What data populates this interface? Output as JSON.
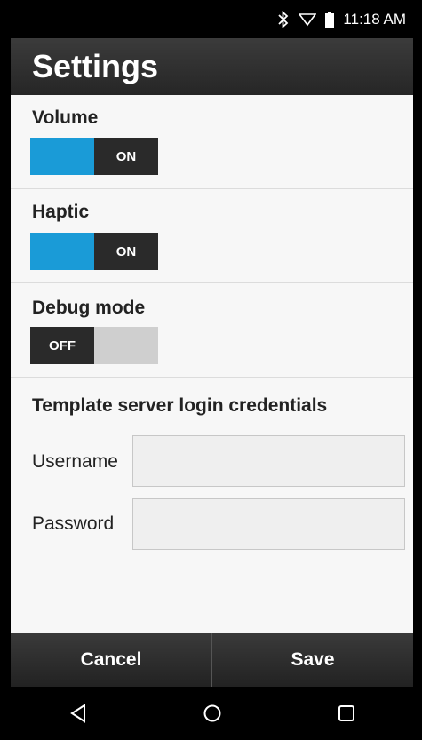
{
  "status_bar": {
    "time": "11:18 AM",
    "icons": [
      "bluetooth-icon",
      "wifi-icon",
      "battery-icon"
    ]
  },
  "app_bar": {
    "title": "Settings"
  },
  "settings": {
    "volume": {
      "label": "Volume",
      "state": "ON"
    },
    "haptic": {
      "label": "Haptic",
      "state": "ON"
    },
    "debug": {
      "label": "Debug mode",
      "state": "OFF"
    }
  },
  "credentials": {
    "title": "Template server login credentials",
    "username_label": "Username",
    "username_value": "",
    "password_label": "Password",
    "password_value": ""
  },
  "actions": {
    "cancel": "Cancel",
    "save": "Save"
  },
  "nav": {
    "icons": [
      "back-icon",
      "home-icon",
      "recents-icon"
    ]
  },
  "colors": {
    "accent": "#1a9bd7",
    "dark": "#2a2a2a",
    "toggle_off": "#cfcfcf"
  }
}
